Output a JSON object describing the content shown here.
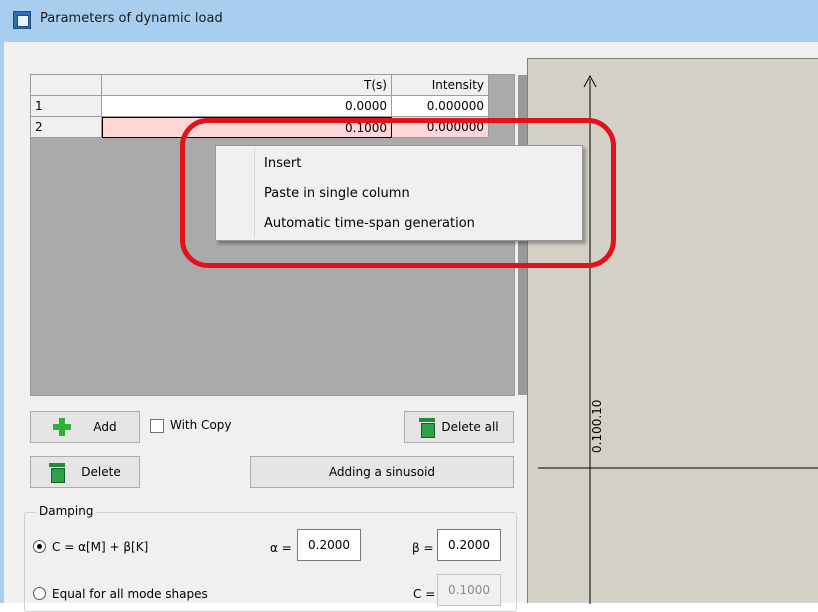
{
  "window": {
    "title": "Parameters of dynamic load"
  },
  "grid": {
    "headers": {
      "t": "T(s)",
      "intensity": "Intensity"
    },
    "rows": [
      {
        "num": "1",
        "t": "0.0000",
        "intensity": "0.000000"
      },
      {
        "num": "2",
        "t": "0.1000",
        "intensity": "0.000000"
      }
    ]
  },
  "context_menu": {
    "items": [
      "Insert",
      "Paste in single column",
      "Automatic time-span generation"
    ]
  },
  "plot": {
    "axis_label": "0.100.10"
  },
  "buttons": {
    "add": "Add",
    "with_copy": "With Copy",
    "delete_all": "Delete all",
    "delete": "Delete",
    "adding_sinusoid": "Adding a sinusoid"
  },
  "damping": {
    "legend": "Damping",
    "option_rayleigh": "C = α[M] + β[K]",
    "alpha_label": "α =",
    "alpha_value": "0.2000",
    "beta_label": "β =",
    "beta_value": "0.2000",
    "option_equal": "Equal for all mode shapes",
    "c_label": "C =",
    "c_value": "0.1000"
  },
  "colors": {
    "title_bar": "#a9cdef",
    "selected_row": "#fdd7d7",
    "highlight": "#e3121a",
    "plot_bg": "#d4d0c8"
  }
}
